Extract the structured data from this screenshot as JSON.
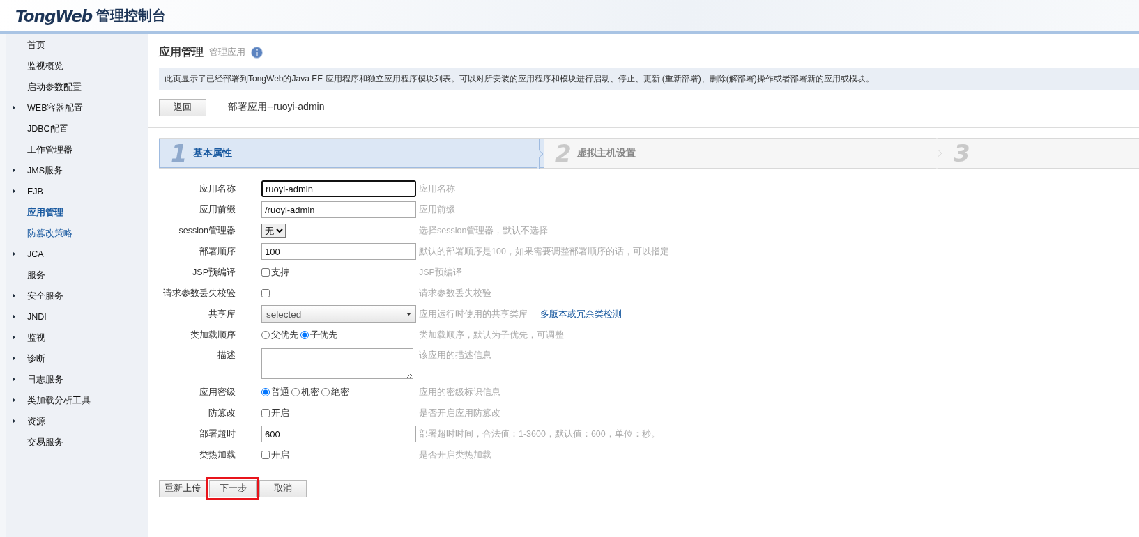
{
  "header": {
    "logo": "TongWeb",
    "title": "管理控制台"
  },
  "sidebar": {
    "items": [
      {
        "label": "首页",
        "expandable": false,
        "selected": false,
        "kind": "normal"
      },
      {
        "label": "监视概览",
        "expandable": false,
        "selected": false,
        "kind": "normal"
      },
      {
        "label": "启动参数配置",
        "expandable": false,
        "selected": false,
        "kind": "normal"
      },
      {
        "label": "WEB容器配置",
        "expandable": true,
        "selected": false,
        "kind": "normal"
      },
      {
        "label": "JDBC配置",
        "expandable": false,
        "selected": false,
        "kind": "normal"
      },
      {
        "label": "工作管理器",
        "expandable": false,
        "selected": false,
        "kind": "normal"
      },
      {
        "label": "JMS服务",
        "expandable": true,
        "selected": false,
        "kind": "normal"
      },
      {
        "label": "EJB",
        "expandable": true,
        "selected": false,
        "kind": "normal"
      },
      {
        "label": "应用管理",
        "expandable": false,
        "selected": true,
        "kind": "normal"
      },
      {
        "label": "防篡改策略",
        "expandable": false,
        "selected": false,
        "kind": "link"
      },
      {
        "label": "JCA",
        "expandable": true,
        "selected": false,
        "kind": "normal"
      },
      {
        "label": "服务",
        "expandable": false,
        "selected": false,
        "kind": "normal"
      },
      {
        "label": "安全服务",
        "expandable": true,
        "selected": false,
        "kind": "normal"
      },
      {
        "label": "JNDI",
        "expandable": true,
        "selected": false,
        "kind": "normal"
      },
      {
        "label": "监视",
        "expandable": true,
        "selected": false,
        "kind": "normal"
      },
      {
        "label": "诊断",
        "expandable": true,
        "selected": false,
        "kind": "normal"
      },
      {
        "label": "日志服务",
        "expandable": true,
        "selected": false,
        "kind": "normal"
      },
      {
        "label": "类加载分析工具",
        "expandable": true,
        "selected": false,
        "kind": "normal"
      },
      {
        "label": "资源",
        "expandable": true,
        "selected": false,
        "kind": "normal"
      },
      {
        "label": "交易服务",
        "expandable": false,
        "selected": false,
        "kind": "normal"
      }
    ]
  },
  "page": {
    "title": "应用管理",
    "subtitle": "管理应用",
    "description": "此页显示了已经部署到TongWeb的Java EE 应用程序和独立应用程序模块列表。可以对所安装的应用程序和模块进行启动、停止、更新 (重新部署)、删除(解部署)操作或者部署新的应用或模块。",
    "back_button": "返回",
    "deploy_title": "部署应用--ruoyi-admin"
  },
  "steps": [
    {
      "number": "1",
      "label": "基本属性",
      "selected": true
    },
    {
      "number": "2",
      "label": "虚拟主机设置",
      "selected": false
    },
    {
      "number": "3",
      "selected": false
    }
  ],
  "form": [
    {
      "kind": "text",
      "label": "应用名称",
      "value": "ruoyi-admin",
      "focused": true,
      "hint": "应用名称"
    },
    {
      "kind": "text",
      "label": "应用前缀",
      "value": "/ruoyi-admin",
      "focused": false,
      "hint": "应用前缀"
    },
    {
      "kind": "select",
      "label": "session管理器",
      "value": "无",
      "hint": "选择session管理器，默认不选择"
    },
    {
      "kind": "text",
      "label": "部署顺序",
      "value": "100",
      "focused": false,
      "hint": "默认的部署顺序是100，如果需要调整部署顺序的话，可以指定"
    },
    {
      "kind": "checkbox",
      "label": "JSP预编译",
      "option": "支持",
      "checked": false,
      "hint": "JSP预编译"
    },
    {
      "kind": "checkbox",
      "label": "请求参数丢失校验",
      "checked": false,
      "hint": "请求参数丢失校验"
    },
    {
      "kind": "dropdown",
      "label": "共享库",
      "value": "selected",
      "hint": "应用运行时使用的共享类库",
      "link": "多版本或冗余类检测"
    },
    {
      "kind": "radio",
      "label": "类加载顺序",
      "options": [
        {
          "label": "父优先",
          "selected": false
        },
        {
          "label": "子优先",
          "selected": true
        }
      ],
      "hint": "类加载顺序，默认为子优先，可调整"
    },
    {
      "kind": "textarea",
      "label": "描述",
      "hint": "该应用的描述信息"
    },
    {
      "kind": "radio",
      "label": "应用密级",
      "options": [
        {
          "label": "普通",
          "selected": true
        },
        {
          "label": "机密",
          "selected": false
        },
        {
          "label": "绝密",
          "selected": false
        }
      ],
      "hint": "应用的密级标识信息"
    },
    {
      "kind": "checkbox",
      "label": "防篡改",
      "option": "开启",
      "checked": false,
      "hint": "是否开启应用防篡改"
    },
    {
      "kind": "text",
      "label": "部署超时",
      "value": "600",
      "focused": false,
      "hint": "部署超时时间，合法值：1-3600，默认值：600，单位：秒。"
    },
    {
      "kind": "checkbox",
      "label": "类热加载",
      "option": "开启",
      "checked": false,
      "hint": "是否开启类热加载"
    }
  ],
  "buttons": [
    {
      "label": "重新上传",
      "highlighted": false
    },
    {
      "label": "下一步",
      "highlighted": true
    },
    {
      "label": "取消",
      "highlighted": false
    }
  ]
}
